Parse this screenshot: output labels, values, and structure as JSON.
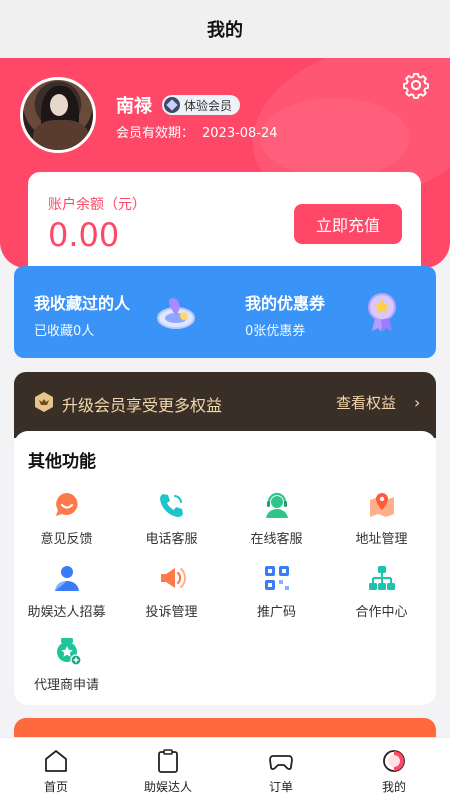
{
  "topbar": {
    "title": "我的"
  },
  "profile": {
    "name": "南禄",
    "member_badge": "体验会员",
    "expiry_label": "会员有效期：",
    "expiry_date": "2023-08-24"
  },
  "balance": {
    "label": "账户余额（元）",
    "amount": "0.00",
    "recharge_label": "立即充值"
  },
  "quick": {
    "favorites_title": "我收藏过的人",
    "favorites_sub": "已收藏0人",
    "coupons_title": "我的优惠券",
    "coupons_sub": "0张优惠券"
  },
  "vip": {
    "text": "升级会员享受更多权益",
    "link": "查看权益"
  },
  "functions": {
    "title": "其他功能",
    "items": [
      {
        "label": "意见反馈",
        "icon": "feedback-icon"
      },
      {
        "label": "电话客服",
        "icon": "phone-icon"
      },
      {
        "label": "在线客服",
        "icon": "online-service-icon"
      },
      {
        "label": "地址管理",
        "icon": "address-icon"
      },
      {
        "label": "助娱达人招募",
        "icon": "recruit-icon"
      },
      {
        "label": "投诉管理",
        "icon": "complaint-icon"
      },
      {
        "label": "推广码",
        "icon": "qrcode-icon"
      },
      {
        "label": "合作中心",
        "icon": "cooperation-icon"
      },
      {
        "label": "代理商申请",
        "icon": "agent-icon"
      }
    ]
  },
  "tabbar": {
    "items": [
      {
        "label": "首页",
        "icon": "home-icon"
      },
      {
        "label": "助娱达人",
        "icon": "clipboard-icon"
      },
      {
        "label": "订单",
        "icon": "gamepad-icon"
      },
      {
        "label": "我的",
        "icon": "profile-icon"
      }
    ],
    "active_index": 3
  },
  "colors": {
    "primary": "#ff4868",
    "blue": "#3a93f7",
    "vip_bg": "#3a2f26",
    "vip_text": "#f2d7ac"
  }
}
